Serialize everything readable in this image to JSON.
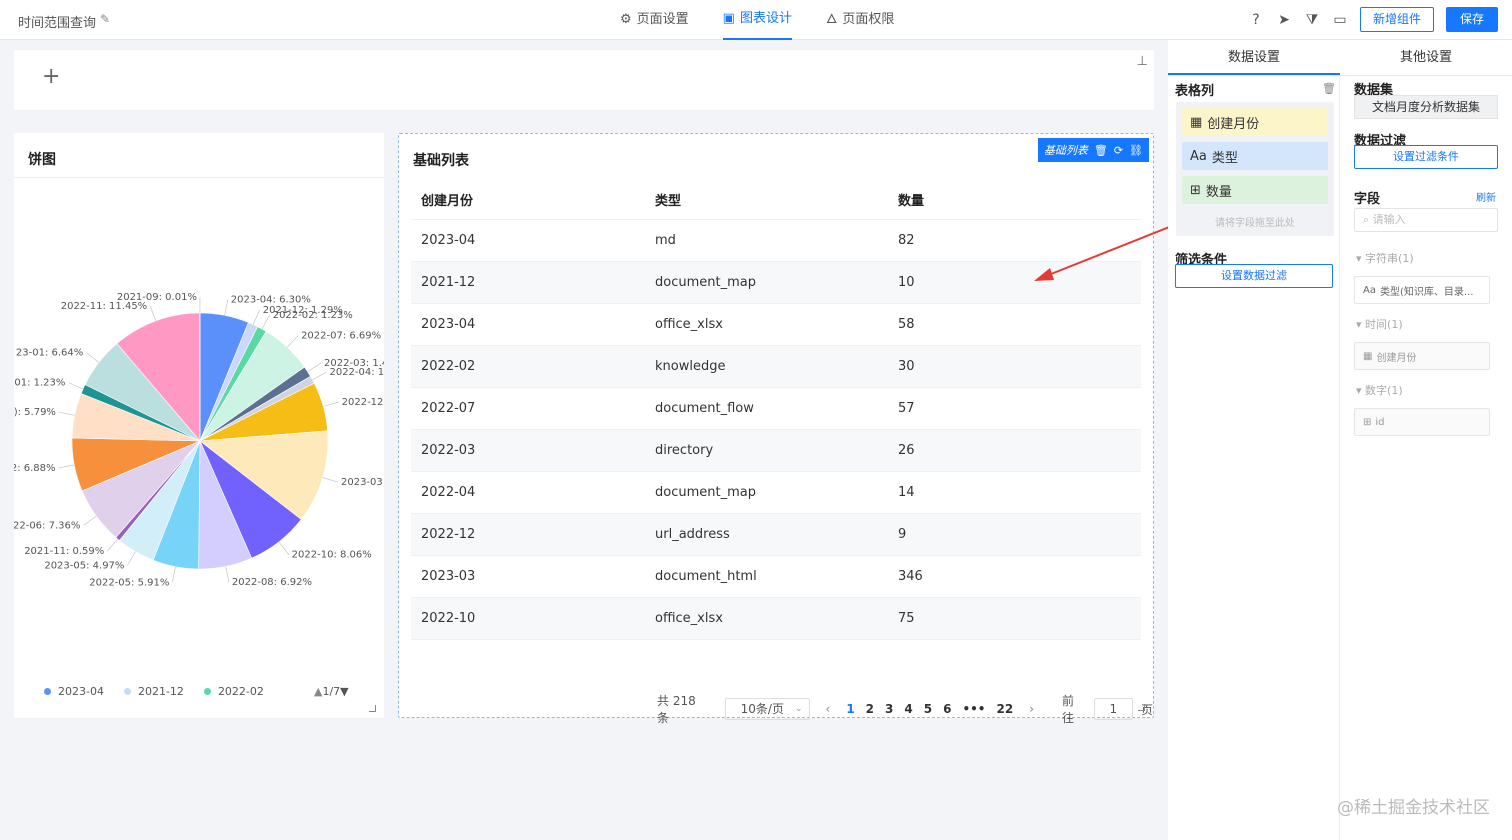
{
  "topbar": {
    "title": "时间范围查询",
    "tabs": [
      {
        "label": "页面设置",
        "icon": "gear-icon"
      },
      {
        "label": "图表设计",
        "icon": "chart-icon"
      },
      {
        "label": "页面权限",
        "icon": "lock-icon"
      }
    ],
    "add_component": "新增组件",
    "save": "保存"
  },
  "pie": {
    "title": "饼图",
    "legend": [
      {
        "label": "2023-04",
        "color": "#5b8ff9"
      },
      {
        "label": "2021-12",
        "color": "#c9d8fb"
      },
      {
        "label": "2022-02",
        "color": "#5ad8a6"
      }
    ],
    "legend_page": "1/7",
    "chart_data": {
      "type": "pie",
      "slices": [
        {
          "label": "2023-04: 6.30%",
          "value": 6.3,
          "color": "#5b8ff9"
        },
        {
          "label": "2021-12: 1.29%",
          "value": 1.29,
          "color": "#c9d8fb"
        },
        {
          "label": "2022-02: 1.23%",
          "value": 1.23,
          "color": "#5ad8a6"
        },
        {
          "label": "2022-07: 6.69%",
          "value": 6.69,
          "color": "#cdf3e4"
        },
        {
          "label": "2022-03: 1.4",
          "value": 1.4,
          "color": "#5d7092"
        },
        {
          "label": "2022-04: 1",
          "value": 1.0,
          "color": "#cfd5e0"
        },
        {
          "label": "2022-12",
          "value": 6.3,
          "color": "#f6bd16"
        },
        {
          "label": "2023-03",
          "value": 12.0,
          "color": "#fde9b9"
        },
        {
          "label": "2022-10: 8.06%",
          "value": 8.06,
          "color": "#7262fd"
        },
        {
          "label": "2022-08: 6.92%",
          "value": 6.92,
          "color": "#d3cefe"
        },
        {
          "label": "2022-05: 5.91%",
          "value": 5.91,
          "color": "#78d3f8"
        },
        {
          "label": "2023-05: 4.97%",
          "value": 4.97,
          "color": "#d2eef9"
        },
        {
          "label": "2021-11: 0.59%",
          "value": 0.59,
          "color": "#9661bc"
        },
        {
          "label": "022-06: 7.36%",
          "value": 7.36,
          "color": "#e0d0ec"
        },
        {
          "label": "2: 6.88%",
          "value": 6.88,
          "color": "#f6903d"
        },
        {
          "label": "): 5.79%",
          "value": 5.79,
          "color": "#ffe0c7"
        },
        {
          "label": "01: 1.23%",
          "value": 1.23,
          "color": "#1e9493"
        },
        {
          "label": "23-01: 6.64%",
          "value": 6.64,
          "color": "#bbdede"
        },
        {
          "label": "2022-11: 11.45%",
          "value": 11.45,
          "color": "#ff99c3"
        },
        {
          "label": "2021-09: 0.01%",
          "value": 0.01,
          "color": "#ffd6e7"
        }
      ]
    }
  },
  "table": {
    "title": "基础列表",
    "tag": "基础列表",
    "columns": [
      "创建月份",
      "类型",
      "数量"
    ],
    "rows": [
      [
        "2023-04",
        "md",
        "82"
      ],
      [
        "2021-12",
        "document_map",
        "10"
      ],
      [
        "2023-04",
        "office_xlsx",
        "58"
      ],
      [
        "2022-02",
        "knowledge",
        "30"
      ],
      [
        "2022-07",
        "document_flow",
        "57"
      ],
      [
        "2022-03",
        "directory",
        "26"
      ],
      [
        "2022-04",
        "document_map",
        "14"
      ],
      [
        "2022-12",
        "url_address",
        "9"
      ],
      [
        "2023-03",
        "document_html",
        "346"
      ],
      [
        "2022-10",
        "office_xlsx",
        "75"
      ]
    ],
    "pager": {
      "total": "共 218 条",
      "size": "10条/页",
      "pages": [
        "1",
        "2",
        "3",
        "4",
        "5",
        "6",
        "•••",
        "22"
      ],
      "goto_label": "前往",
      "goto_value": "1",
      "page_unit": "页"
    }
  },
  "panel": {
    "tabs": [
      "数据设置",
      "其他设置"
    ],
    "columns_title": "表格列",
    "fields": [
      "创建月份",
      "类型",
      "数量"
    ],
    "drop_hint": "请将字段拖至此处",
    "filter_title": "筛选条件",
    "filter_btn": "设置数据过滤",
    "dataset_title": "数据集",
    "dataset_value": "文档月度分析数据集",
    "datafilter_title": "数据过滤",
    "datafilter_btn": "设置过滤条件",
    "field_title": "字段",
    "refresh": "刷新",
    "search_placeholder": "请输入",
    "groups": [
      {
        "label": "字符串(1)",
        "item": "类型(知识库、目录..."
      },
      {
        "label": "时间(1)",
        "item": "创建月份"
      },
      {
        "label": "数字(1)",
        "item": "id"
      }
    ]
  },
  "watermark": "@稀土掘金技术社区"
}
